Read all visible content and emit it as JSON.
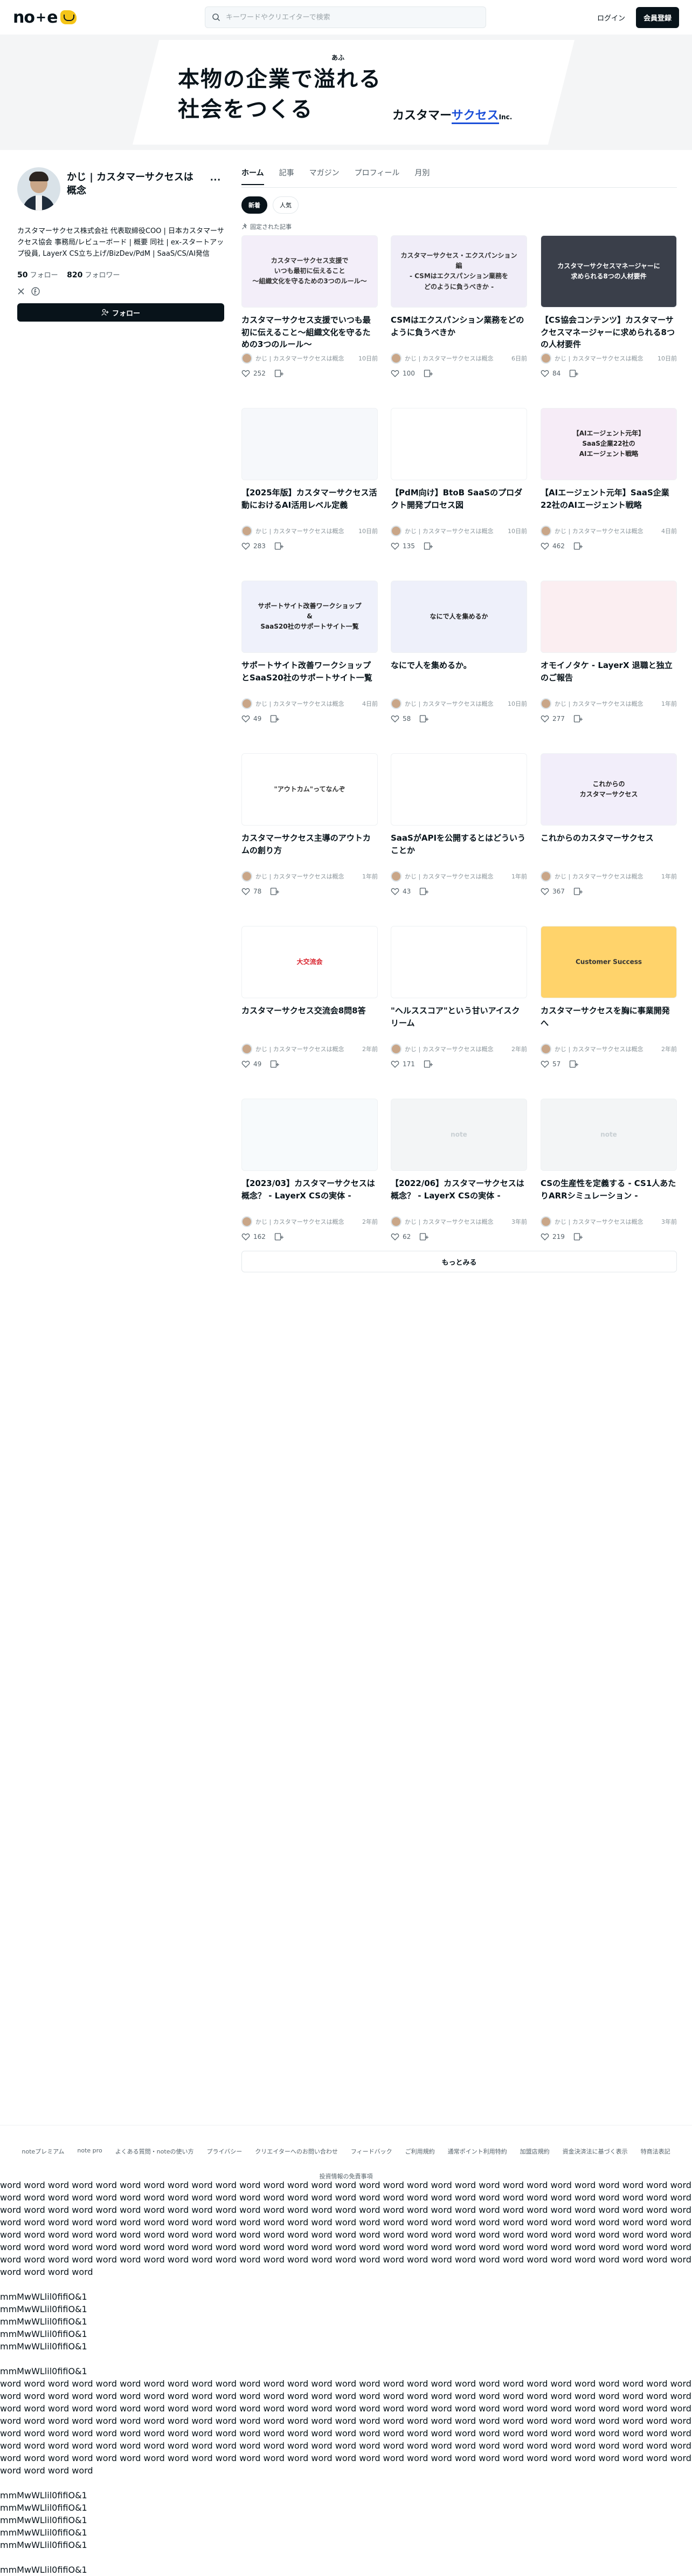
{
  "header": {
    "search_placeholder": "キーワードやクリエイターで検索",
    "login": "ログイン",
    "signup": "会員登録"
  },
  "hero": {
    "ruby": "あふ",
    "line1": "本物の企業で溢れる",
    "line2": "社会をつくる",
    "brand_a": "カスタマー",
    "brand_b": "サクセス",
    "brand_c": "Inc."
  },
  "profile": {
    "name": "かじ | カスタマーサクセスは概念",
    "bio": "カスタマーサクセス株式会社 代表取締役COO | 日本カスタマーサクセス協会 事務局/レビューボード | 概要 同社 | ex-スタートアップ役員, LayerX CS立ち上げ/BizDev/PdM | SaaS/CS/AI発信",
    "following_count": "50",
    "following_label": "フォロー",
    "followers_count": "820",
    "followers_label": "フォロワー",
    "follow_button": "フォロー"
  },
  "tabs": [
    "ホーム",
    "記事",
    "マガジン",
    "プロフィール",
    "月別"
  ],
  "subtabs": [
    "新着",
    "人気"
  ],
  "pinned_label": "固定された記事",
  "author_short": "かじ | カスタマーサクセスは概念",
  "cards": [
    {
      "title": "カスタマーサクセス支援でいつも最初に伝えること〜組織文化を守るための3つのルール〜",
      "date": "10日前",
      "likes": "252",
      "thumb_text": "カスタマーサクセス支援で\nいつも最初に伝えること\n〜組織文化を守るための3つのルール〜",
      "bg": "#f3eef9",
      "fg": "#333333"
    },
    {
      "title": "CSMはエクスパンション業務をどのように負うべきか",
      "date": "6日前",
      "likes": "100",
      "thumb_text": "カスタマーサクセス・エクスパンション編\n- CSMはエクスパンション業務を\nどのように負うべきか -",
      "bg": "#f0edf8",
      "fg": "#333333"
    },
    {
      "title": "【CS協会コンテンツ】カスタマーサクセスマネージャーに求められる8つの人材要件",
      "date": "10日前",
      "likes": "84",
      "thumb_text": "カスタマーサクセスマネージャーに\n求められる8つの人材要件",
      "bg": "#3a3f4a",
      "fg": "#ffffff"
    },
    {
      "title": "【2025年版】カスタマーサクセス活動におけるAI活用レベル定義",
      "date": "10日前",
      "likes": "283",
      "thumb_text": "",
      "bg": "#f6f8fb",
      "fg": "#333333"
    },
    {
      "title": "【PdM向け】BtoB SaaSのプロダクト開発プロセス図",
      "date": "10日前",
      "likes": "135",
      "thumb_text": "",
      "bg": "#ffffff",
      "fg": "#333333"
    },
    {
      "title": "【AIエージェント元年】SaaS企業22社のAIエージェント戦略",
      "date": "4日前",
      "likes": "462",
      "thumb_text": "【AIエージェント元年】\nSaaS企業22社の\nAIエージェント戦略",
      "bg": "#f6ecf7",
      "fg": "#222222"
    },
    {
      "title": "サポートサイト改善ワークショップとSaaS20社のサポートサイト一覧",
      "date": "4日前",
      "likes": "49",
      "thumb_text": "サポートサイト改善ワークショップ\n&\nSaaS20社のサポートサイト一覧",
      "bg": "#eff1fb",
      "fg": "#222222"
    },
    {
      "title": "なにで人を集めるか。",
      "date": "10日前",
      "likes": "58",
      "thumb_text": "なにで人を集めるか",
      "bg": "#eef0fa",
      "fg": "#222222"
    },
    {
      "title": "オモイノタケ - LayerX 退職と独立のご報告",
      "date": "1年前",
      "likes": "277",
      "thumb_text": "",
      "bg": "#fbeef1",
      "fg": "#333333"
    },
    {
      "title": "カスタマーサクセス主導のアウトカムの創り方",
      "date": "1年前",
      "likes": "78",
      "thumb_text": "\"アウトカム\"ってなんぞ",
      "bg": "#ffffff",
      "fg": "#333333"
    },
    {
      "title": "SaaSがAPIを公開するとはどういうことか",
      "date": "1年前",
      "likes": "43",
      "thumb_text": "",
      "bg": "#ffffff",
      "fg": "#333333"
    },
    {
      "title": "これからのカスタマーサクセス",
      "date": "1年前",
      "likes": "367",
      "thumb_text": "これからの\nカスタマーサクセス",
      "bg": "#f2eefa",
      "fg": "#222222"
    },
    {
      "title": "カスタマーサクセス交流会8問8答",
      "date": "2年前",
      "likes": "49",
      "thumb_text": "大交流会",
      "bg": "#ffffff",
      "fg": "#d9232d"
    },
    {
      "title": "\"ヘルススコア\"という甘いアイスクリーム",
      "date": "2年前",
      "likes": "171",
      "thumb_text": "",
      "bg": "#ffffff",
      "fg": "#333333"
    },
    {
      "title": "カスタマーサクセスを胸に事業開発へ",
      "date": "2年前",
      "likes": "57",
      "thumb_text": "Customer Success",
      "bg": "#ffd36b",
      "fg": "#333333"
    },
    {
      "title": "【2023/03】カスタマーサクセスは概念？ - LayerX CSの実体 -",
      "date": "2年前",
      "likes": "162",
      "thumb_text": "",
      "bg": "#f7fafc",
      "fg": "#333333"
    },
    {
      "title": "【2022/06】カスタマーサクセスは概念？ - LayerX CSの実体 -",
      "date": "3年前",
      "likes": "62",
      "thumb_text": "note",
      "bg": "#f3f5f6",
      "fg": "#c8cfd3"
    },
    {
      "title": "CSの生産性を定義する - CS1人あたりARRシミュレーション -",
      "date": "3年前",
      "likes": "219",
      "thumb_text": "note",
      "bg": "#f3f5f6",
      "fg": "#c8cfd3"
    }
  ],
  "more_button": "もっとみる",
  "footer": {
    "links": [
      "noteプレミアム",
      "note pro",
      "よくある質問・noteの使い方",
      "プライバシー",
      "クリエイターへのお問い合わせ",
      "フィードバック",
      "ご利用規約",
      "通常ポイント利用特約",
      "加盟店規約",
      "資金決済法に基づく表示",
      "特商法表記"
    ],
    "last_link": "投資情報の免責事項"
  },
  "filler": {
    "word_block": "word word word word word word word word word word word word word word word word word word word word word word word word word word word word word word word word word word word word word word word word word word word word word word word word word word word word word word word word word word word word word word word word word word word word word word word word word word word word word word word word word word word word word word word word word word word word word word word word word word word word word word word word word word word word word word word word word word word word word word word word word word word word word word word word word word word word word word word word word word word word word word word word word word word word word word word word word word word word word word word word word word word word word word word word word word word word word word word word word word word word word word word word word word word word word word word word word word word word word word word word word word word word word word word",
    "mono_lines": [
      "mmMwWLlil0fifiO&1",
      "mmMwWLlil0fifiO&1",
      "mmMwWLlil0fifiO&1",
      "mmMwWLlil0fifiO&1",
      "mmMwWLlil0fifiO&1"
    ],
    "single_line": "mmMwWLlil0fifiO&1"
  }
}
